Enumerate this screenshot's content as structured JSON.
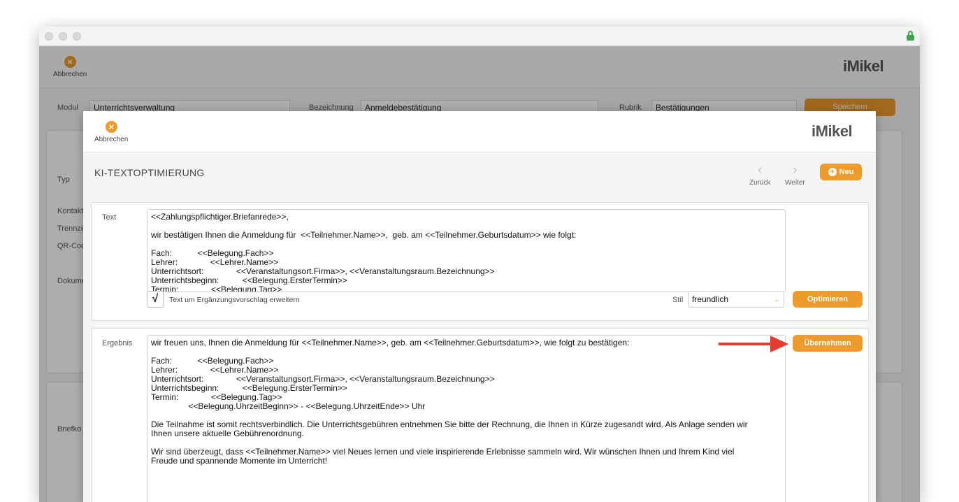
{
  "background_app": {
    "toolbar": {
      "cancel_label": "Abbrechen",
      "logo": "iMikel"
    },
    "form": {
      "modul_label": "Modul",
      "modul_value": "Unterrichtsverwaltung",
      "bezeichnung_label": "Bezeichnung",
      "bezeichnung_value": "Anmeldebestätigung",
      "rubrik_label": "Rubrik",
      "rubrik_value": "Bestätigungen",
      "save_label": "Speichern"
    },
    "side_labels": [
      "Typ",
      "Kontakt",
      "Trennze",
      "QR-Cod",
      "Dokume",
      "Briefko"
    ]
  },
  "modal": {
    "toolbar": {
      "cancel_label": "Abbrechen",
      "logo": "iMikel"
    },
    "title": "KI-TEXTOPTIMIERUNG",
    "nav": {
      "back_label": "Zurück",
      "next_label": "Weiter",
      "new_label": "Neu"
    },
    "text_section": {
      "label": "Text",
      "value": "<<Zahlungspflichtiger.Briefanrede>>,\n\nwir bestätigen Ihnen die Anmeldung für  <<Teilnehmer.Name>>,  geb. am <<Teilnehmer.Geburtsdatum>> wie folgt:\n\nFach:           <<Belegung.Fach>>\nLehrer:              <<Lehrer.Name>>\nUnterrichtsort:              <<Veranstaltungsort.Firma>>, <<Veranstaltungsraum.Bezeichnung>>\nUnterrichtsbeginn:          <<Belegung.ErsterTermin>>\nTermin:              <<Belegung.Tag>>",
      "checkbox_mark": "√",
      "checkbox_label": "Text um Ergänzungsvorschlag erweitern",
      "stil_label": "Stil",
      "stil_value": "freundlich",
      "optimize_label": "Optimieren"
    },
    "result_section": {
      "label": "Ergebnis",
      "value": "wir freuen uns, Ihnen die Anmeldung für <<Teilnehmer.Name>>, geb. am <<Teilnehmer.Geburtsdatum>>, wie folgt zu bestätigen:\n\nFach:           <<Belegung.Fach>>\nLehrer:              <<Lehrer.Name>>\nUnterrichtsort:              <<Veranstaltungsort.Firma>>, <<Veranstaltungsraum.Bezeichnung>>\nUnterrichtsbeginn:          <<Belegung.ErsterTermin>>\nTermin:              <<Belegung.Tag>>\n                <<Belegung.UhrzeitBeginn>> - <<Belegung.UhrzeitEnde>> Uhr\n\nDie Teilnahme ist somit rechtsverbindlich. Die Unterrichtsgebühren entnehmen Sie bitte der Rechnung, die Ihnen in Kürze zugesandt wird. Als Anlage senden wir\nIhnen unsere aktuelle Gebührenordnung.\n\nWir sind überzeugt, dass <<Teilnehmer.Name>> viel Neues lernen und viele inspirierende Erlebnisse sammeln wird. Wir wünschen Ihnen und Ihrem Kind viel\nFreude und spannende Momente im Unterricht!",
      "apply_label": "Übernehmen"
    }
  },
  "colors": {
    "accent": "#ee9b2c",
    "arrow": "#e53a2f"
  }
}
